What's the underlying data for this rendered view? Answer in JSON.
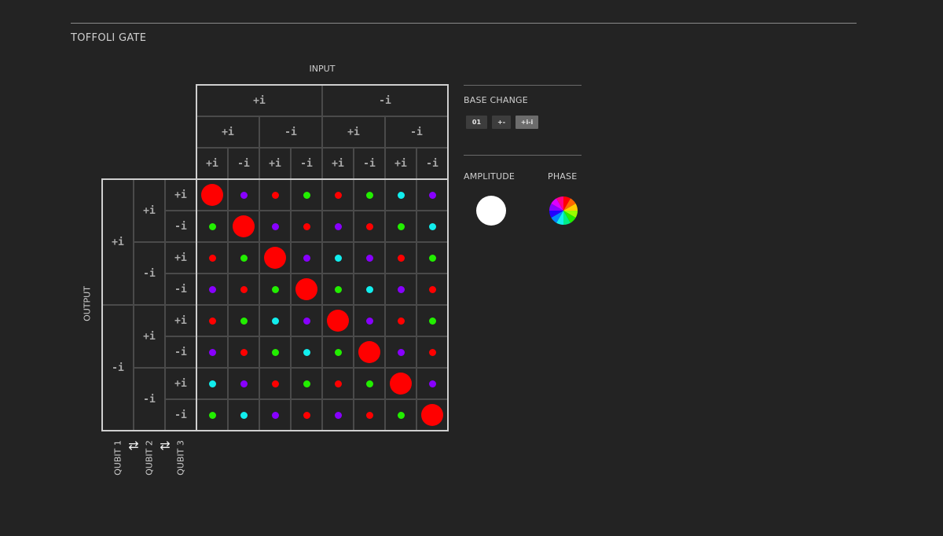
{
  "page": {
    "title": "TOFFOLI GATE",
    "input_label": "INPUT",
    "output_label": "OUTPUT"
  },
  "matrix": {
    "level1_labels": [
      "+i",
      "-i"
    ],
    "level2_labels": [
      "+i",
      "-i",
      "+i",
      "-i"
    ],
    "level3_labels": [
      "+i",
      "-i",
      "+i",
      "-i",
      "+i",
      "-i",
      "+i",
      "-i"
    ],
    "qubit_labels": [
      "QUBIT 1",
      "QUBIT 2",
      "QUBIT 3"
    ],
    "swap_icon": "⇄",
    "colors": {
      "red": "#ff0000",
      "green": "#22ee00",
      "purple": "#8800ff",
      "cyan": "#11eeee"
    },
    "rows": [
      [
        "BR",
        "p",
        "r",
        "g",
        "r",
        "g",
        "c",
        "p"
      ],
      [
        "g",
        "BR",
        "p",
        "r",
        "p",
        "r",
        "g",
        "c"
      ],
      [
        "r",
        "g",
        "BR",
        "p",
        "c",
        "p",
        "r",
        "g"
      ],
      [
        "p",
        "r",
        "g",
        "BR",
        "g",
        "c",
        "p",
        "r"
      ],
      [
        "r",
        "g",
        "c",
        "p",
        "BR",
        "p",
        "r",
        "g"
      ],
      [
        "p",
        "r",
        "g",
        "c",
        "g",
        "BR",
        "p",
        "r"
      ],
      [
        "c",
        "p",
        "r",
        "g",
        "r",
        "g",
        "BR",
        "p"
      ],
      [
        "g",
        "c",
        "p",
        "r",
        "p",
        "r",
        "g",
        "BR"
      ]
    ]
  },
  "side_panel": {
    "base_change_label": "BASE CHANGE",
    "base_buttons": [
      "01",
      "+-",
      "+i-i"
    ],
    "active_base": 2,
    "amplitude_label": "AMPLITUDE",
    "phase_label": "PHASE"
  }
}
